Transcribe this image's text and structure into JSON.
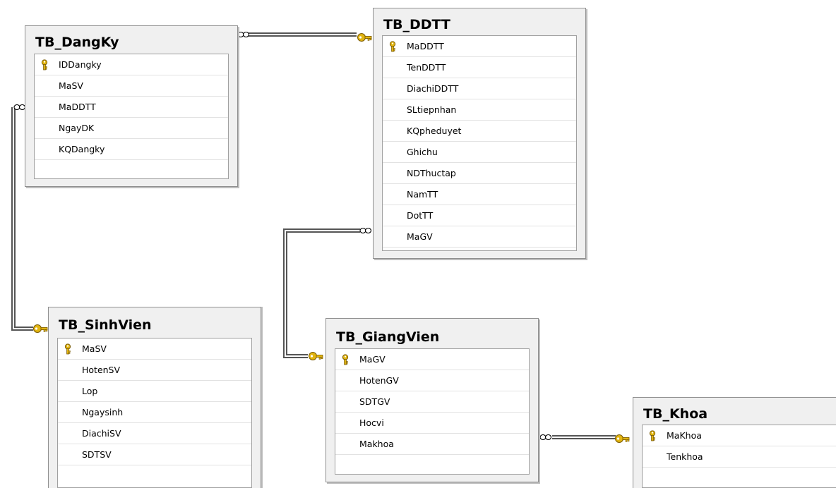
{
  "tables": [
    {
      "id": "TB_DangKy",
      "title": "TB_DangKy",
      "fields": [
        {
          "name": "IDDangky",
          "pk": true
        },
        {
          "name": "MaSV",
          "pk": false
        },
        {
          "name": "MaDDTT",
          "pk": false
        },
        {
          "name": "NgayDK",
          "pk": false
        },
        {
          "name": "KQDangky",
          "pk": false
        }
      ]
    },
    {
      "id": "TB_DDTT",
      "title": "TB_DDTT",
      "fields": [
        {
          "name": "MaDDTT",
          "pk": true
        },
        {
          "name": "TenDDTT",
          "pk": false
        },
        {
          "name": "DiachiDDTT",
          "pk": false
        },
        {
          "name": "SLtiepnhan",
          "pk": false
        },
        {
          "name": "KQpheduyet",
          "pk": false
        },
        {
          "name": "Ghichu",
          "pk": false
        },
        {
          "name": "NDThuctap",
          "pk": false
        },
        {
          "name": "NamTT",
          "pk": false
        },
        {
          "name": "DotTT",
          "pk": false
        },
        {
          "name": "MaGV",
          "pk": false
        }
      ]
    },
    {
      "id": "TB_SinhVien",
      "title": "TB_SinhVien",
      "fields": [
        {
          "name": "MaSV",
          "pk": true
        },
        {
          "name": "HotenSV",
          "pk": false
        },
        {
          "name": "Lop",
          "pk": false
        },
        {
          "name": "Ngaysinh",
          "pk": false
        },
        {
          "name": "DiachiSV",
          "pk": false
        },
        {
          "name": "SDTSV",
          "pk": false
        }
      ]
    },
    {
      "id": "TB_GiangVien",
      "title": "TB_GiangVien",
      "fields": [
        {
          "name": "MaGV",
          "pk": true
        },
        {
          "name": "HotenGV",
          "pk": false
        },
        {
          "name": "SDTGV",
          "pk": false
        },
        {
          "name": "Hocvi",
          "pk": false
        },
        {
          "name": "Makhoa",
          "pk": false
        }
      ]
    },
    {
      "id": "TB_Khoa",
      "title": "TB_Khoa",
      "fields": [
        {
          "name": "MaKhoa",
          "pk": true
        },
        {
          "name": "Tenkhoa",
          "pk": false
        }
      ]
    }
  ],
  "relationships": [
    {
      "from": "TB_DangKy",
      "to": "TB_DDTT"
    },
    {
      "from": "TB_DangKy",
      "to": "TB_SinhVien"
    },
    {
      "from": "TB_DDTT",
      "to": "TB_GiangVien"
    },
    {
      "from": "TB_GiangVien",
      "to": "TB_Khoa"
    }
  ],
  "colors": {
    "key_gold": "#e2b511",
    "key_outline": "#7a5a00",
    "line": "#555555",
    "line_fill": "#ffffff"
  },
  "icons": {
    "primary_key": "key-icon",
    "many_end": "infinity-icon",
    "one_end": "key-icon"
  }
}
